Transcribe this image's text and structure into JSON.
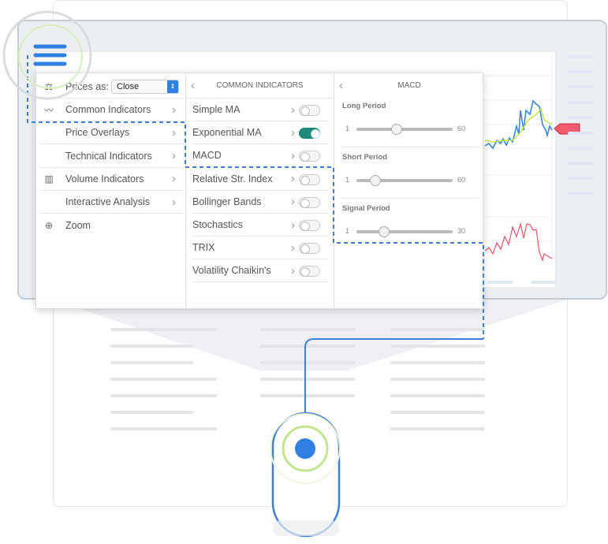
{
  "left_menu": {
    "prices_label": "Prices as:",
    "prices_value": "Close",
    "items": [
      {
        "label": "Common Indicators",
        "icon": "line-chart-icon"
      },
      {
        "label": "Price Overlays",
        "icon": ""
      },
      {
        "label": "Technical Indicators",
        "icon": ""
      },
      {
        "label": "Volume Indicators",
        "icon": "bar-chart-icon"
      },
      {
        "label": "Interactive Analysis",
        "icon": ""
      },
      {
        "label": "Zoom",
        "icon": "zoom-in-icon"
      }
    ]
  },
  "common_indicators": {
    "title": "COMMON INDICATORS",
    "items": [
      {
        "label": "Simple MA",
        "on": false
      },
      {
        "label": "Exponential MA",
        "on": true
      },
      {
        "label": "MACD",
        "on": false
      },
      {
        "label": "Relative Str. Index",
        "on": false
      },
      {
        "label": "Bollinger Bands",
        "on": false
      },
      {
        "label": "Stochastics",
        "on": false
      },
      {
        "label": "TRIX",
        "on": false
      },
      {
        "label": "Volatility Chaikin's",
        "on": false
      }
    ]
  },
  "macd": {
    "title": "MACD",
    "params": [
      {
        "label": "Long Period",
        "min": "1",
        "max": "60",
        "value_fraction": 0.42
      },
      {
        "label": "Short Period",
        "min": "1",
        "max": "60",
        "value_fraction": 0.2
      },
      {
        "label": "Signal Period",
        "min": "1",
        "max": "30",
        "value_fraction": 0.29
      }
    ]
  },
  "colors": {
    "accent": "#2f80e0",
    "toggle_on": "#1f8a78",
    "highlight": "#b8e07a",
    "marker": "#f25a6e"
  }
}
